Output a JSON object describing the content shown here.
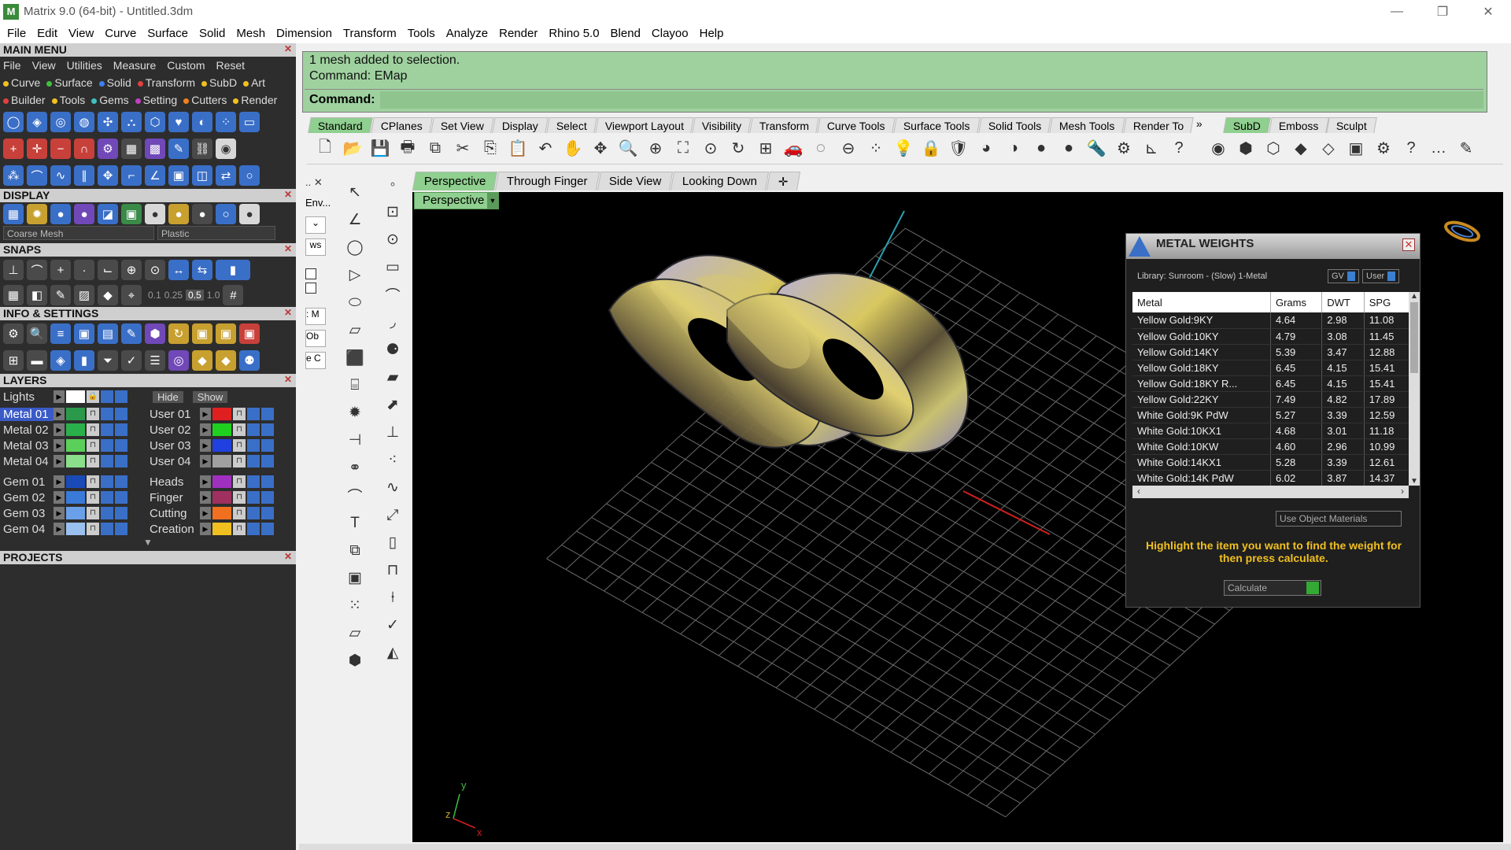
{
  "title_bar": {
    "title": "Matrix 9.0 (64-bit) - Untitled.3dm",
    "min": "—",
    "max": "❐",
    "close": "✕"
  },
  "menu": [
    "File",
    "Edit",
    "View",
    "Curve",
    "Surface",
    "Solid",
    "Mesh",
    "Dimension",
    "Transform",
    "Tools",
    "Analyze",
    "Render",
    "Rhino 5.0",
    "Blend",
    "Clayoo",
    "Help"
  ],
  "main_menu": {
    "title": "MAIN MENU",
    "submenu": [
      "File",
      "View",
      "Utilities",
      "Measure",
      "Custom",
      "Reset"
    ],
    "row1": [
      {
        "label": "Curve",
        "color": "#f0c020"
      },
      {
        "label": "Surface",
        "color": "#40c040"
      },
      {
        "label": "Solid",
        "color": "#4080f0"
      },
      {
        "label": "Transform",
        "color": "#e04040"
      },
      {
        "label": "SubD",
        "color": "#f0c020"
      },
      {
        "label": "Art",
        "color": "#f0c020"
      }
    ],
    "row2": [
      {
        "label": "Builder",
        "color": "#e04040"
      },
      {
        "label": "Tools",
        "color": "#f0c020"
      },
      {
        "label": "Gems",
        "color": "#40c0c0"
      },
      {
        "label": "Setting",
        "color": "#c040c0"
      },
      {
        "label": "Cutters",
        "color": "#f08020"
      },
      {
        "label": "Render",
        "color": "#f0c020"
      }
    ]
  },
  "display": {
    "title": "DISPLAY",
    "mesh_select": "Coarse Mesh",
    "material_select": "Plastic"
  },
  "snaps": {
    "title": "SNAPS",
    "values": [
      "0.1",
      "0.25",
      "0.5",
      "1.0"
    ]
  },
  "info": {
    "title": "INFO & SETTINGS"
  },
  "layers": {
    "title": "LAYERS",
    "lights": "Lights",
    "hide": "Hide",
    "show": "Show",
    "left": [
      {
        "name": "Metal 01",
        "color": "#2a9a4a",
        "active": true
      },
      {
        "name": "Metal 02",
        "color": "#2ab04a"
      },
      {
        "name": "Metal 03",
        "color": "#5ad05a"
      },
      {
        "name": "Metal 04",
        "color": "#8ae08a"
      },
      {
        "name": "Gem 01",
        "color": "#1a4ab8"
      },
      {
        "name": "Gem 02",
        "color": "#3a7ad8"
      },
      {
        "name": "Gem 03",
        "color": "#6aa0e8"
      },
      {
        "name": "Gem 04",
        "color": "#9ac0f0"
      }
    ],
    "right": [
      {
        "name": "User 01",
        "color": "#e02020"
      },
      {
        "name": "User 02",
        "color": "#20d020"
      },
      {
        "name": "User 03",
        "color": "#2040e0"
      },
      {
        "name": "User 04",
        "color": "#a0a0a0"
      },
      {
        "name": "Heads",
        "color": "#a030c0"
      },
      {
        "name": "Finger",
        "color": "#a03060"
      },
      {
        "name": "Cutting",
        "color": "#f07020"
      },
      {
        "name": "Creation",
        "color": "#f0c020"
      }
    ]
  },
  "projects": {
    "title": "PROJECTS"
  },
  "command": {
    "line1": "1 mesh added to selection.",
    "line2": "Command: EMap",
    "prompt": "Command:"
  },
  "tool_tabs": [
    "Standard",
    "CPlanes",
    "Set View",
    "Display",
    "Select",
    "Viewport Layout",
    "Visibility",
    "Transform",
    "Curve Tools",
    "Surface Tools",
    "Solid Tools",
    "Mesh Tools",
    "Render To"
  ],
  "tool_tabs_right": [
    "SubD",
    "Emboss",
    "Sculpt"
  ],
  "side_labels": [
    "Env...",
    "ws",
    ": M",
    "Ob",
    "e C"
  ],
  "viewport_tabs": [
    "Perspective",
    "Through Finger",
    "Side View",
    "Looking Down"
  ],
  "viewport_label": "Perspective",
  "axis": {
    "x": "x",
    "y": "y",
    "z": "z"
  },
  "metal_weights": {
    "title": "METAL WEIGHTS",
    "library": "Library: Sunroom - (Slow) 1-Metal",
    "gv": "GV",
    "user": "User",
    "columns": [
      "Metal",
      "Grams",
      "DWT",
      "SPG"
    ],
    "rows": [
      [
        "Yellow Gold:9KY",
        "4.64",
        "2.98",
        "11.08"
      ],
      [
        "Yellow Gold:10KY",
        "4.79",
        "3.08",
        "11.45"
      ],
      [
        "Yellow Gold:14KY",
        "5.39",
        "3.47",
        "12.88"
      ],
      [
        "Yellow Gold:18KY",
        "6.45",
        "4.15",
        "15.41"
      ],
      [
        "Yellow Gold:18KY R...",
        "6.45",
        "4.15",
        "15.41"
      ],
      [
        "Yellow Gold:22KY",
        "7.49",
        "4.82",
        "17.89"
      ],
      [
        "White Gold:9K PdW",
        "5.27",
        "3.39",
        "12.59"
      ],
      [
        "White Gold:10KX1",
        "4.68",
        "3.01",
        "11.18"
      ],
      [
        "White Gold:10KW",
        "4.60",
        "2.96",
        "10.99"
      ],
      [
        "White Gold:14KX1",
        "5.28",
        "3.39",
        "12.61"
      ],
      [
        "White Gold:14K PdW",
        "6.02",
        "3.87",
        "14.37"
      ]
    ],
    "use_object_materials": "Use Object Materials",
    "hint": "Highlight the item you want to find the weight for then press calculate.",
    "calculate": "Calculate"
  }
}
